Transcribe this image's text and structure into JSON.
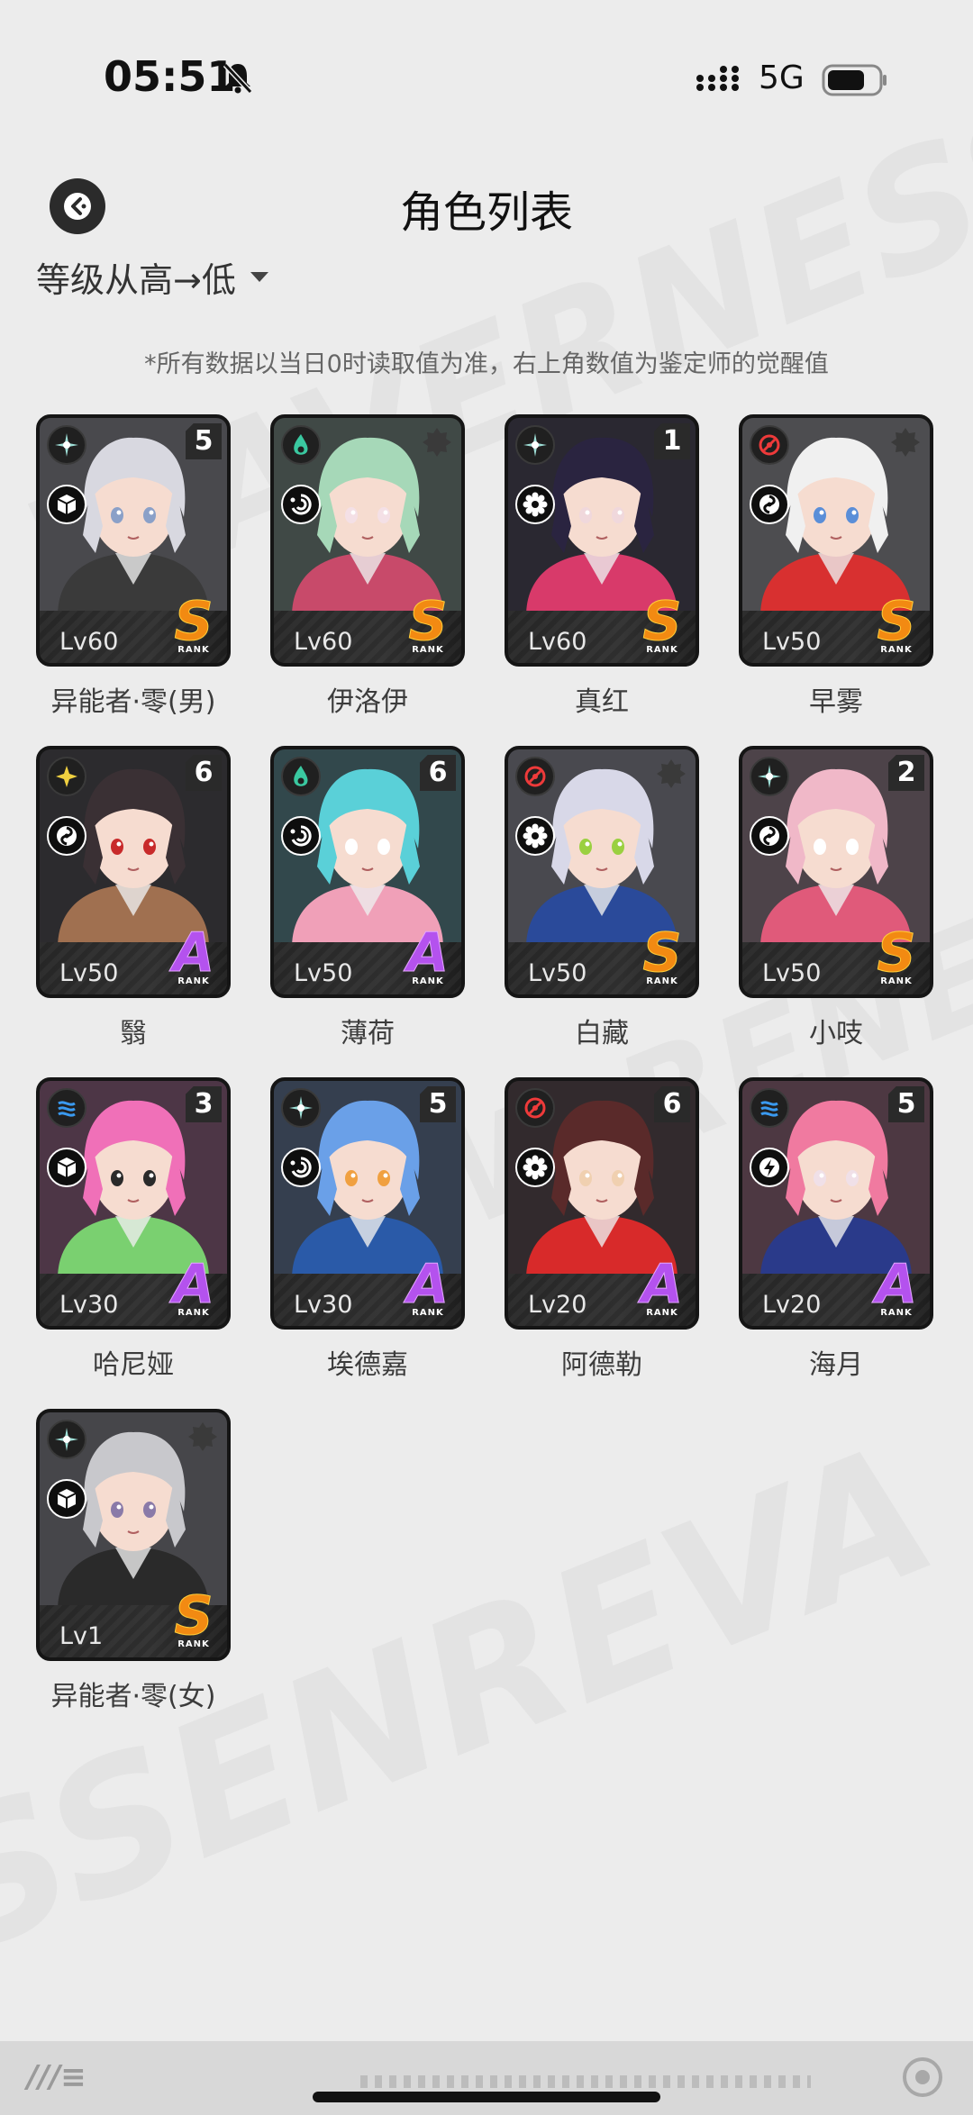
{
  "status_bar": {
    "time": "05:51",
    "network": "5G"
  },
  "header": {
    "title": "角色列表"
  },
  "sort": {
    "label": "等级从高→低"
  },
  "notice": "*所有数据以当日0时读取值为准，右上角数值为鉴定师的觉醒值",
  "colors": {
    "rank_S": "#f28a12",
    "rank_A": "#b452ee",
    "card_bg": "#1c1c1c",
    "page_bg": "#ececec"
  },
  "characters": [
    {
      "name": "异能者·零(男)",
      "level": "Lv60",
      "rank": "S",
      "rank_sub": "RANK",
      "awaken": "5",
      "element_icon": "shine-icon",
      "role_icon": "cube-icon",
      "palette": [
        "#d8d8e0",
        "#3a3a3a",
        "#8aa0c8"
      ]
    },
    {
      "name": "伊洛伊",
      "level": "Lv60",
      "rank": "S",
      "rank_sub": "RANK",
      "awaken": "",
      "element_icon": "flame-green-icon",
      "role_icon": "swirl-icon",
      "palette": [
        "#a6d8b8",
        "#c84a6a",
        "#f4e0e6"
      ]
    },
    {
      "name": "真红",
      "level": "Lv60",
      "rank": "S",
      "rank_sub": "RANK",
      "awaken": "1",
      "element_icon": "shine-icon",
      "role_icon": "gear-icon",
      "palette": [
        "#2a2440",
        "#d83a6a",
        "#f0d8dc"
      ]
    },
    {
      "name": "早雾",
      "level": "Lv50",
      "rank": "S",
      "rank_sub": "RANK",
      "awaken": "",
      "element_icon": "target-icon",
      "role_icon": "vortex-icon",
      "palette": [
        "#f0f0f0",
        "#d83030",
        "#5a8ed8"
      ]
    },
    {
      "name": "翳",
      "level": "Lv50",
      "rank": "A",
      "rank_sub": "RANK",
      "awaken": "6",
      "element_icon": "star-yellow-icon",
      "role_icon": "vortex-icon",
      "palette": [
        "#3a3034",
        "#a07050",
        "#c82a2a"
      ]
    },
    {
      "name": "薄荷",
      "level": "Lv50",
      "rank": "A",
      "rank_sub": "RANK",
      "awaken": "6",
      "element_icon": "flame-green-icon",
      "role_icon": "swirl-icon",
      "palette": [
        "#5ad0d8",
        "#f0a0b8",
        "#ffffff"
      ]
    },
    {
      "name": "白藏",
      "level": "Lv50",
      "rank": "S",
      "rank_sub": "RANK",
      "awaken": "",
      "element_icon": "target-icon",
      "role_icon": "gear-icon",
      "palette": [
        "#d8d8e8",
        "#2a4a9a",
        "#9ad040"
      ]
    },
    {
      "name": "小吱",
      "level": "Lv50",
      "rank": "S",
      "rank_sub": "RANK",
      "awaken": "2",
      "element_icon": "shine-icon",
      "role_icon": "vortex-icon",
      "palette": [
        "#f0b8c8",
        "#e05a7a",
        "#ffffff"
      ]
    },
    {
      "name": "哈尼娅",
      "level": "Lv30",
      "rank": "A",
      "rank_sub": "RANK",
      "awaken": "3",
      "element_icon": "water-icon",
      "role_icon": "cube-icon",
      "palette": [
        "#f070b8",
        "#7ad070",
        "#2a2a2a"
      ]
    },
    {
      "name": "埃德嘉",
      "level": "Lv30",
      "rank": "A",
      "rank_sub": "RANK",
      "awaken": "5",
      "element_icon": "shine-icon",
      "role_icon": "swirl-icon",
      "palette": [
        "#6aa0e8",
        "#2a5aa8",
        "#f0a040"
      ]
    },
    {
      "name": "阿德勒",
      "level": "Lv20",
      "rank": "A",
      "rank_sub": "RANK",
      "awaken": "6",
      "element_icon": "target-icon",
      "role_icon": "gear-icon",
      "palette": [
        "#5a2a2a",
        "#d82a2a",
        "#f0d0b0"
      ]
    },
    {
      "name": "海月",
      "level": "Lv20",
      "rank": "A",
      "rank_sub": "RANK",
      "awaken": "5",
      "element_icon": "water-icon",
      "role_icon": "bolt-icon",
      "palette": [
        "#f07aa0",
        "#2a3a8a",
        "#f0e0e8"
      ]
    },
    {
      "name": "异能者·零(女)",
      "level": "Lv1",
      "rank": "S",
      "rank_sub": "RANK",
      "awaken": "",
      "element_icon": "shine-icon",
      "role_icon": "cube-icon",
      "palette": [
        "#c8c8cc",
        "#2a2a2a",
        "#8a7aa8"
      ]
    }
  ]
}
